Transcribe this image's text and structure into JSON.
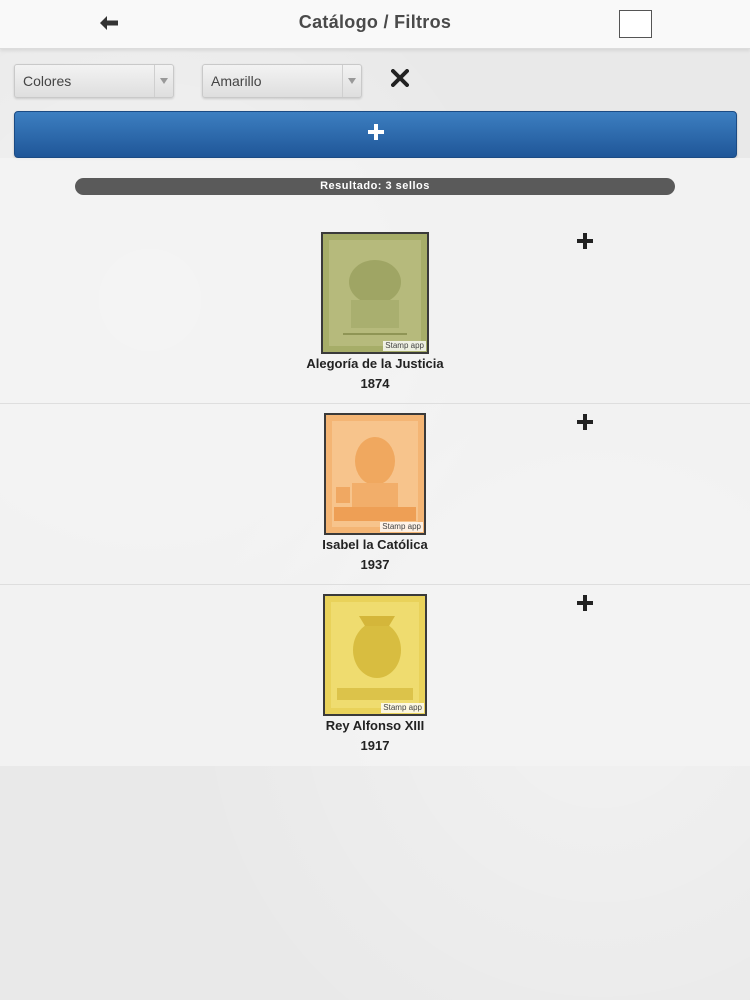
{
  "header": {
    "title": "Catálogo / Filtros",
    "back_icon": "arrow-left-icon"
  },
  "filters": {
    "category_value": "Colores",
    "color_value": "Amarillo",
    "clear_icon": "close-icon"
  },
  "add_button": {
    "icon": "plus-icon"
  },
  "results": {
    "label": "Resultado: 3 sellos"
  },
  "stamps": [
    {
      "name": "Alegoría de la Justicia",
      "year": "1874",
      "watermark": "Stamp app"
    },
    {
      "name": "Isabel la Católica",
      "year": "1937",
      "watermark": "Stamp app"
    },
    {
      "name": "Rey Alfonso XIII",
      "year": "1917",
      "watermark": "Stamp app"
    }
  ],
  "colors": {
    "accent": "#2a65a8",
    "result_bar": "#5a5a5a"
  }
}
